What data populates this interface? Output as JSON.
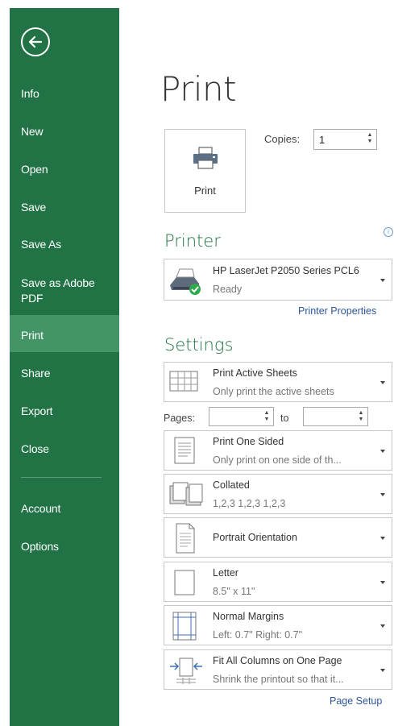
{
  "sidebar": {
    "items": [
      {
        "label": "Info"
      },
      {
        "label": "New"
      },
      {
        "label": "Open"
      },
      {
        "label": "Save"
      },
      {
        "label": "Save As"
      },
      {
        "label": "Save as Adobe PDF"
      },
      {
        "label": "Print"
      },
      {
        "label": "Share"
      },
      {
        "label": "Export"
      },
      {
        "label": "Close"
      },
      {
        "label": "Account"
      },
      {
        "label": "Options"
      }
    ],
    "active": "Print",
    "colors": {
      "background": "#217346",
      "active": "#439467"
    }
  },
  "main": {
    "title": "Print",
    "print_button_label": "Print",
    "copies_label": "Copies:",
    "copies_value": "1",
    "printer_heading": "Printer",
    "printer": {
      "name": "HP LaserJet P2050 Series PCL6",
      "status": "Ready"
    },
    "printer_properties_link": "Printer Properties",
    "settings_heading": "Settings",
    "settings": [
      {
        "title": "Print Active Sheets",
        "subtitle": "Only print the active sheets"
      },
      {
        "title": "Print One Sided",
        "subtitle": "Only print on one side of th..."
      },
      {
        "title": "Collated",
        "subtitle": "1,2,3    1,2,3    1,2,3"
      },
      {
        "title": "Portrait Orientation",
        "subtitle": ""
      },
      {
        "title": "Letter",
        "subtitle": "8.5\" x 11\""
      },
      {
        "title": "Normal Margins",
        "subtitle": "Left: 0.7\"    Right: 0.7\""
      },
      {
        "title": "Fit All Columns on One Page",
        "subtitle": "Shrink the printout so that it..."
      }
    ],
    "pages_label": "Pages:",
    "pages_from": "",
    "pages_to_label": "to",
    "pages_to": "",
    "page_setup_link": "Page Setup",
    "accent": "#217346",
    "link_color": "#2b579a"
  }
}
